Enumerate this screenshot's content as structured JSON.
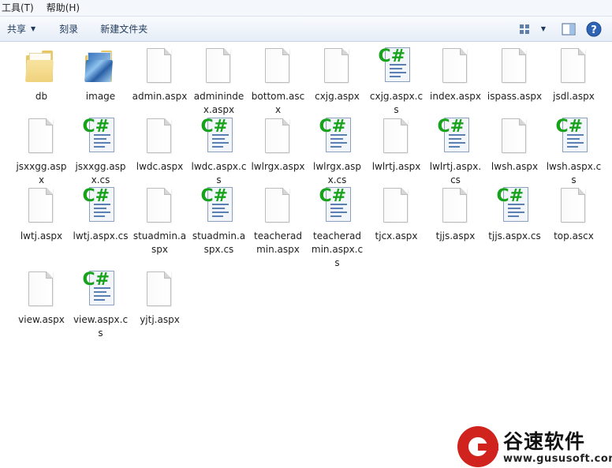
{
  "menu": {
    "tools": "工具(T)",
    "help": "帮助(H)"
  },
  "toolbar": {
    "share": "共享",
    "burn": "刻录",
    "new_folder": "新建文件夹"
  },
  "files": [
    {
      "name": "db",
      "type": "folder"
    },
    {
      "name": "image",
      "type": "image-folder"
    },
    {
      "name": "admin.aspx",
      "type": "page"
    },
    {
      "name": "adminindex.aspx",
      "type": "page"
    },
    {
      "name": "bottom.ascx",
      "type": "page"
    },
    {
      "name": "cxjg.aspx",
      "type": "page"
    },
    {
      "name": "cxjg.aspx.cs",
      "type": "csharp"
    },
    {
      "name": "index.aspx",
      "type": "page"
    },
    {
      "name": "ispass.aspx",
      "type": "page"
    },
    {
      "name": "jsdl.aspx",
      "type": "page"
    },
    {
      "name": "jsxxgg.aspx",
      "type": "page"
    },
    {
      "name": "jsxxgg.aspx.cs",
      "type": "csharp"
    },
    {
      "name": "lwdc.aspx",
      "type": "page"
    },
    {
      "name": "lwdc.aspx.cs",
      "type": "csharp"
    },
    {
      "name": "lwlrgx.aspx",
      "type": "page"
    },
    {
      "name": "lwlrgx.aspx.cs",
      "type": "csharp"
    },
    {
      "name": "lwlrtj.aspx",
      "type": "page"
    },
    {
      "name": "lwlrtj.aspx.cs",
      "type": "csharp"
    },
    {
      "name": "lwsh.aspx",
      "type": "page"
    },
    {
      "name": "lwsh.aspx.cs",
      "type": "csharp"
    },
    {
      "name": "lwtj.aspx",
      "type": "page"
    },
    {
      "name": "lwtj.aspx.cs",
      "type": "csharp"
    },
    {
      "name": "stuadmin.aspx",
      "type": "page"
    },
    {
      "name": "stuadmin.aspx.cs",
      "type": "csharp"
    },
    {
      "name": "teacheradmin.aspx",
      "type": "page"
    },
    {
      "name": "teacheradmin.aspx.cs",
      "type": "csharp"
    },
    {
      "name": "tjcx.aspx",
      "type": "page"
    },
    {
      "name": "tjjs.aspx",
      "type": "page"
    },
    {
      "name": "tjjs.aspx.cs",
      "type": "csharp"
    },
    {
      "name": "top.ascx",
      "type": "page"
    },
    {
      "name": "view.aspx",
      "type": "page"
    },
    {
      "name": "view.aspx.cs",
      "type": "csharp"
    },
    {
      "name": "yjtj.aspx",
      "type": "page"
    }
  ],
  "watermark": {
    "title": "谷速软件",
    "url": "www.gususoft.com"
  },
  "colors": {
    "csharp_mark": "#17a21c",
    "toolbar_text": "#1e395b",
    "logo_red": "#d0231d"
  }
}
